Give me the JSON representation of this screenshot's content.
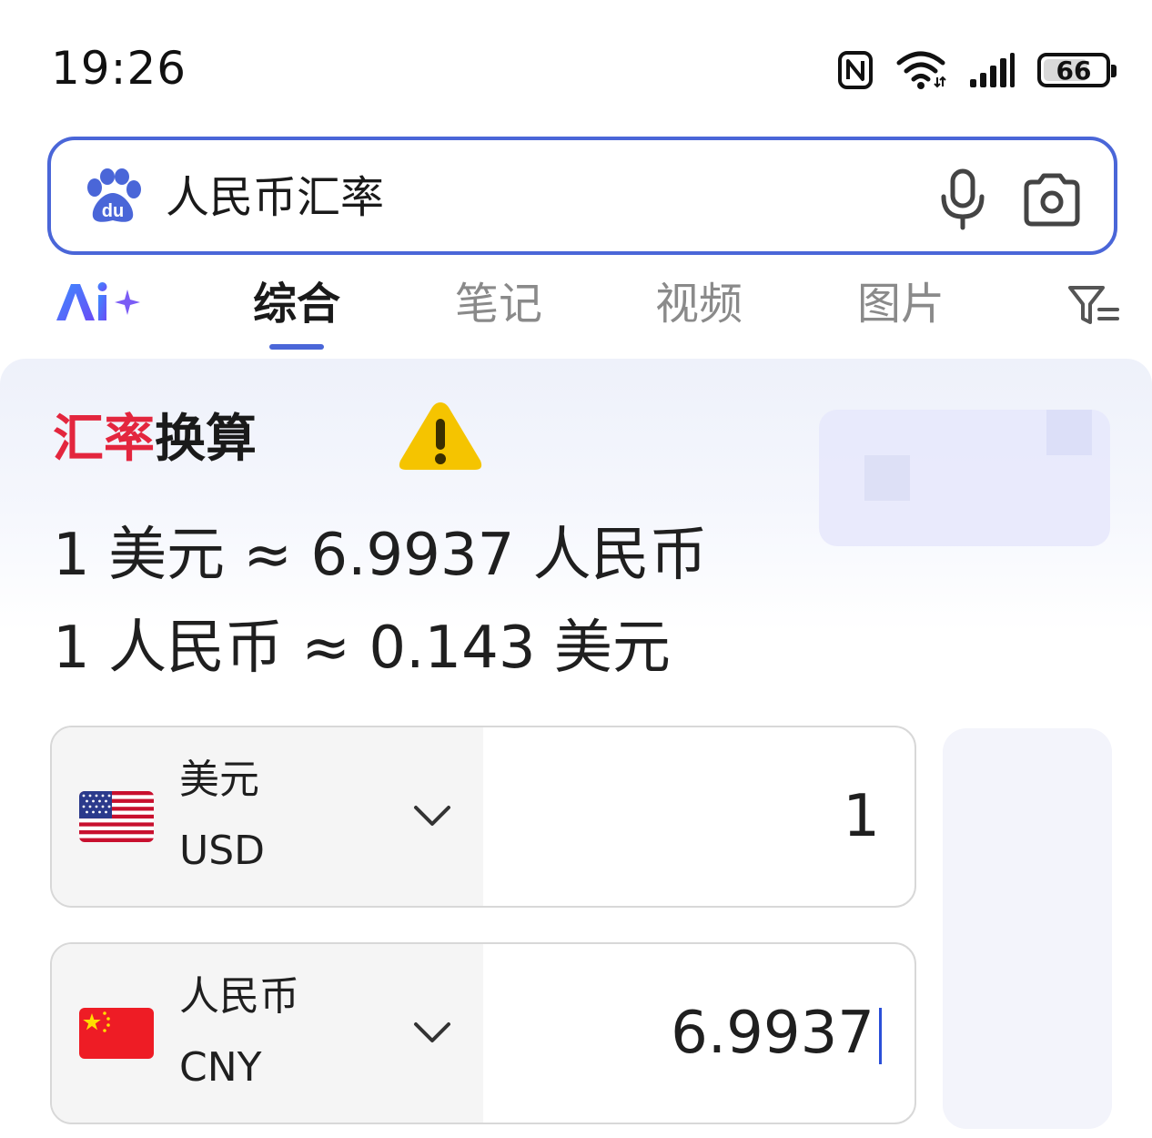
{
  "status_bar": {
    "time": "19:26",
    "battery": "66",
    "icons": [
      "nfc-icon",
      "wifi-icon",
      "signal-icon",
      "battery-icon"
    ]
  },
  "search": {
    "query": "人民币汇率",
    "icons": [
      "baidu-logo",
      "mic-icon",
      "camera-icon"
    ]
  },
  "tabs": {
    "items": [
      {
        "label": "综合",
        "active": true
      },
      {
        "label": "笔记",
        "active": false
      },
      {
        "label": "视频",
        "active": false
      },
      {
        "label": "图片",
        "active": false
      }
    ]
  },
  "card": {
    "title_red": "汇率",
    "title_dark": "换算",
    "rate_usd_to_cny": "1 美元 ≈ 6.9937 人民币",
    "rate_cny_to_usd": "1 人民币 ≈ 0.143 美元"
  },
  "converter": {
    "from": {
      "name": "美元",
      "code": "USD",
      "amount": "1",
      "flag": "us-flag-icon"
    },
    "to": {
      "name": "人民币",
      "code": "CNY",
      "amount": "6.9937",
      "flag": "cn-flag-icon"
    }
  },
  "colors": {
    "accent": "#4a66d8",
    "title_red": "#e3263e",
    "warning": "#f5c400"
  }
}
